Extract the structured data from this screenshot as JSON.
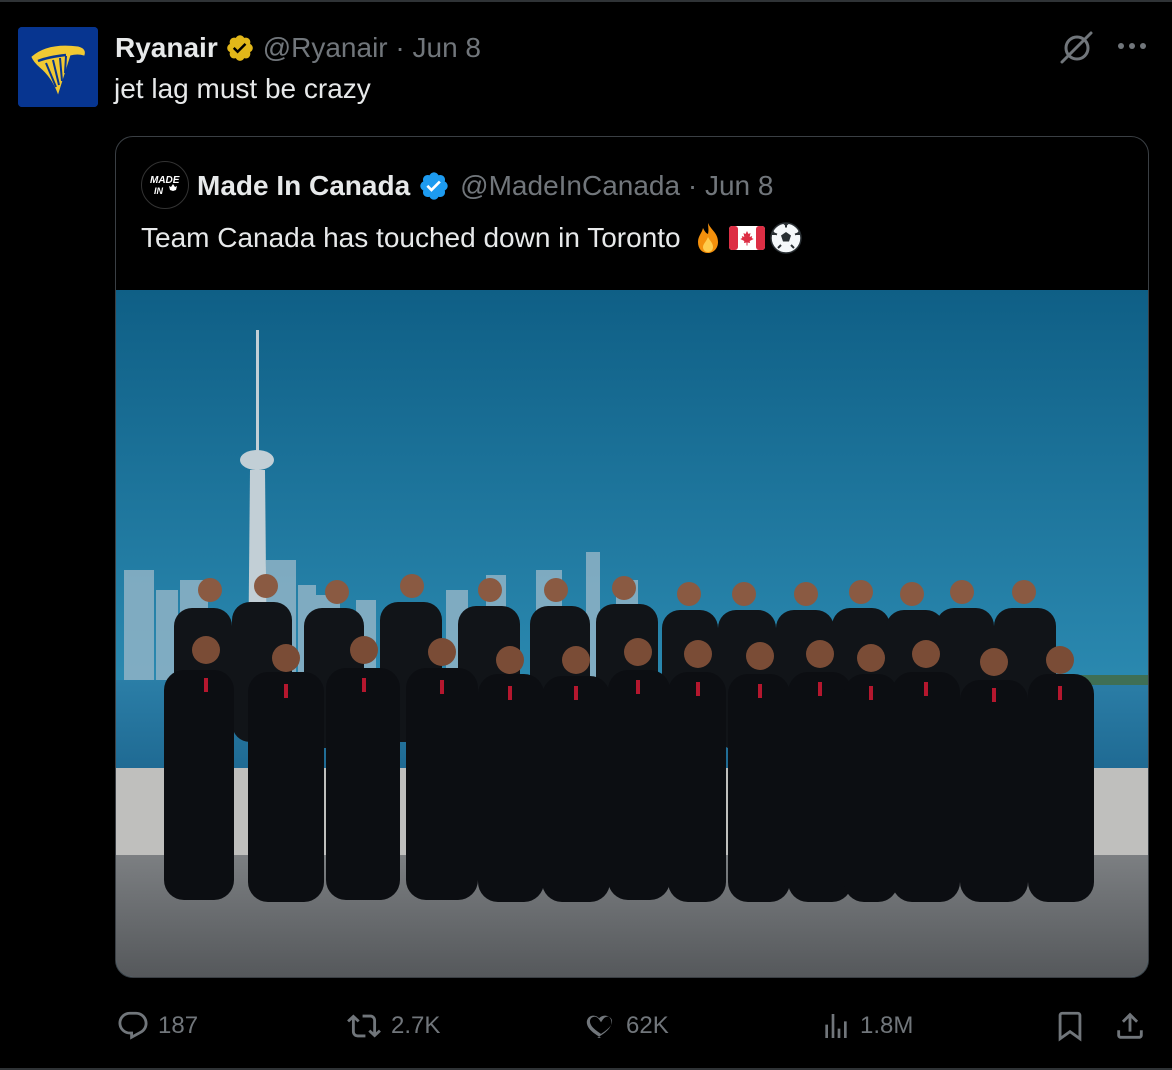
{
  "tweet": {
    "author_name": "Ryanair",
    "handle_date": "@Ryanair · Jun 8",
    "text": "jet lag must be crazy"
  },
  "quoted_tweet": {
    "author_name": "Made In Canada",
    "avatar_text_line1": "MADE",
    "avatar_text_line2": "IN",
    "handle_date": "@MadeInCanada · Jun 8",
    "text": "Team Canada has touched down in Toronto",
    "emojis": [
      "fire-emoji",
      "canada-flag-emoji",
      "soccer-ball-emoji"
    ],
    "image_alt": "Team Canada soccer players in black suits posing in front of Toronto skyline and CN Tower"
  },
  "actions": {
    "replies": "187",
    "reposts": "2.7K",
    "likes": "62K",
    "views": "1.8M"
  },
  "colors": {
    "background": "#000000",
    "text_primary": "#e7e9ea",
    "text_secondary": "#71767b",
    "verified_gold": "#e2b719",
    "verified_blue": "#1d9bf0",
    "ryanair_blue": "#073590",
    "ryanair_yellow": "#f1c933"
  },
  "icons": [
    "ryanair-harp-logo",
    "gold-verified-badge",
    "grok-icon",
    "more-options-icon",
    "blue-verified-badge",
    "reply-icon",
    "repost-icon",
    "like-icon",
    "views-icon",
    "bookmark-icon",
    "share-icon"
  ]
}
